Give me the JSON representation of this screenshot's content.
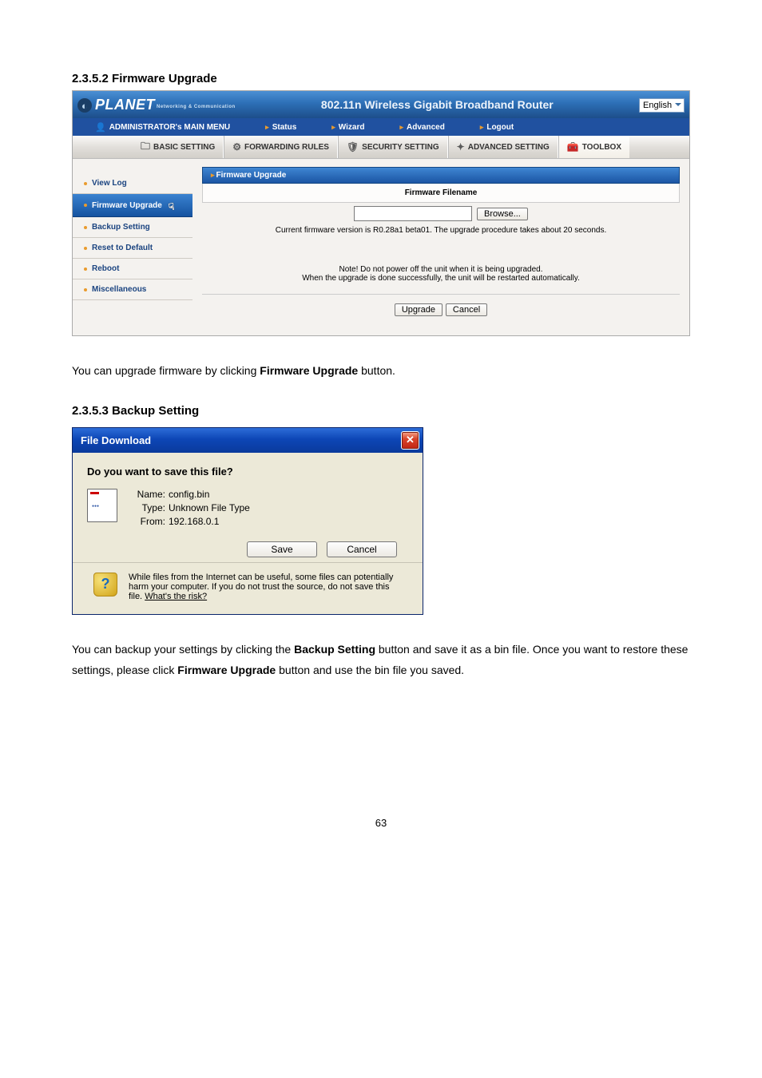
{
  "doc": {
    "heading1": "2.3.5.2 Firmware Upgrade",
    "heading2": "2.3.5.3 Backup Setting",
    "para1_a": "You can upgrade firmware by clicking ",
    "para1_b": "Firmware Upgrade",
    "para1_c": " button.",
    "para2_a": "You can backup your settings by clicking the ",
    "para2_b": "Backup Setting",
    "para2_c": " button and save it as a bin file. Once you want to restore these settings, please click ",
    "para2_d": "Firmware Upgrade",
    "para2_e": " button and use the bin file you saved.",
    "page_number": "63"
  },
  "router": {
    "logo": "PLANET",
    "logo_sub": "Networking & Communication",
    "title": "802.11n Wireless Gigabit Broadband Router",
    "language": "English",
    "admin_menu_title": "ADMINISTRATOR's MAIN MENU",
    "topnav": {
      "status": "Status",
      "wizard": "Wizard",
      "advanced": "Advanced",
      "logout": "Logout"
    },
    "tabs": {
      "basic": "BASIC SETTING",
      "forwarding": "FORWARDING RULES",
      "security": "SECURITY SETTING",
      "advanced": "ADVANCED SETTING",
      "toolbox": "TOOLBOX"
    },
    "sidebar": {
      "items": [
        "View Log",
        "Firmware Upgrade",
        "Backup Setting",
        "Reset to Default",
        "Reboot",
        "Miscellaneous"
      ]
    },
    "pane": {
      "title": "Firmware Upgrade",
      "label": "Firmware Filename",
      "browse": "Browse...",
      "status": "Current firmware version is R0.28a1 beta01. The upgrade procedure takes about 20 seconds.",
      "note1": "Note! Do not power off the unit when it is being upgraded.",
      "note2": "When the upgrade is done successfully, the unit will be restarted automatically.",
      "upgrade_btn": "Upgrade",
      "cancel_btn": "Cancel"
    }
  },
  "dialog": {
    "title": "File Download",
    "question": "Do you want to save this file?",
    "name_k": "Name:",
    "name_v": "config.bin",
    "type_k": "Type:",
    "type_v": "Unknown File Type",
    "from_k": "From:",
    "from_v": "192.168.0.1",
    "save": "Save",
    "cancel": "Cancel",
    "warn": "While files from the Internet can be useful, some files can potentially harm your computer. If you do not trust the source, do not save this file. ",
    "risk": "What's the risk?"
  }
}
